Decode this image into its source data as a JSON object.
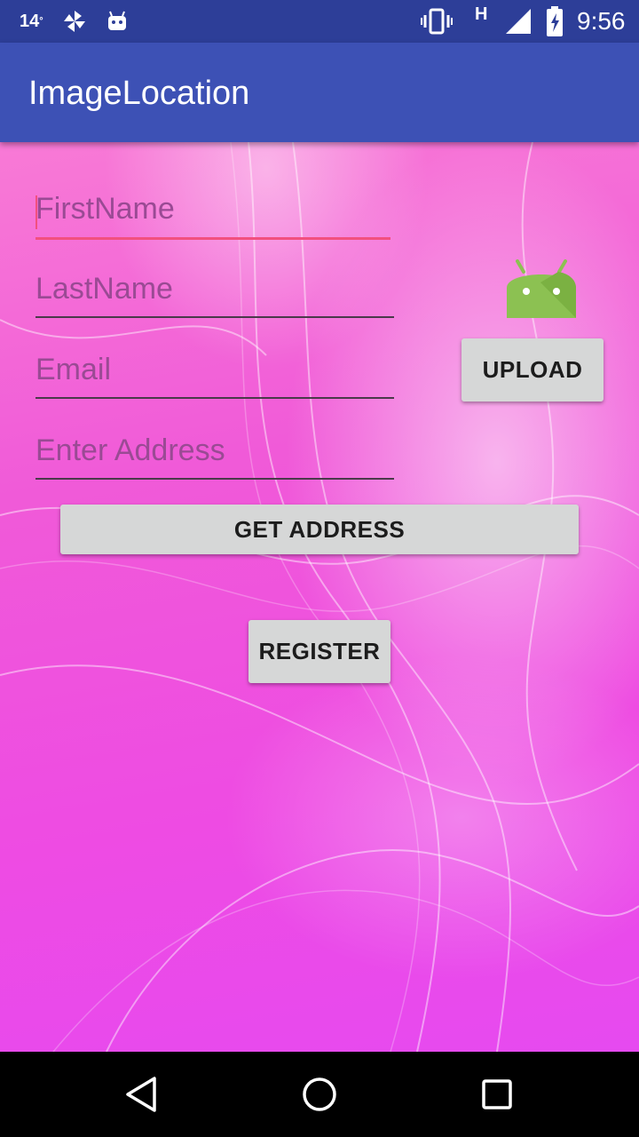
{
  "status_bar": {
    "temperature": "14",
    "temperature_unit": "°",
    "network": "H",
    "time": "9:56",
    "icons": [
      "pinwheel-icon",
      "android-bot-icon",
      "vibrate-icon",
      "signal-icon",
      "battery-charging-icon"
    ]
  },
  "app_bar": {
    "title": "ImageLocation",
    "color": "#3d51b5"
  },
  "form": {
    "first_name": {
      "placeholder": "FirstName",
      "value": ""
    },
    "last_name": {
      "placeholder": "LastName",
      "value": ""
    },
    "email": {
      "placeholder": "Email",
      "value": ""
    },
    "address": {
      "placeholder": "Enter Address",
      "value": ""
    },
    "upload_label": "UPLOAD",
    "get_address_label": "GET ADDRESS",
    "register_label": "REGISTER"
  },
  "nav_bar": {
    "icons": [
      "back-icon",
      "home-icon",
      "recents-icon"
    ]
  },
  "colors": {
    "accent": "#f2507f",
    "status_bar": "#2d3e98",
    "background_pink": "#f05ad8",
    "android_green": "#8cc152"
  }
}
